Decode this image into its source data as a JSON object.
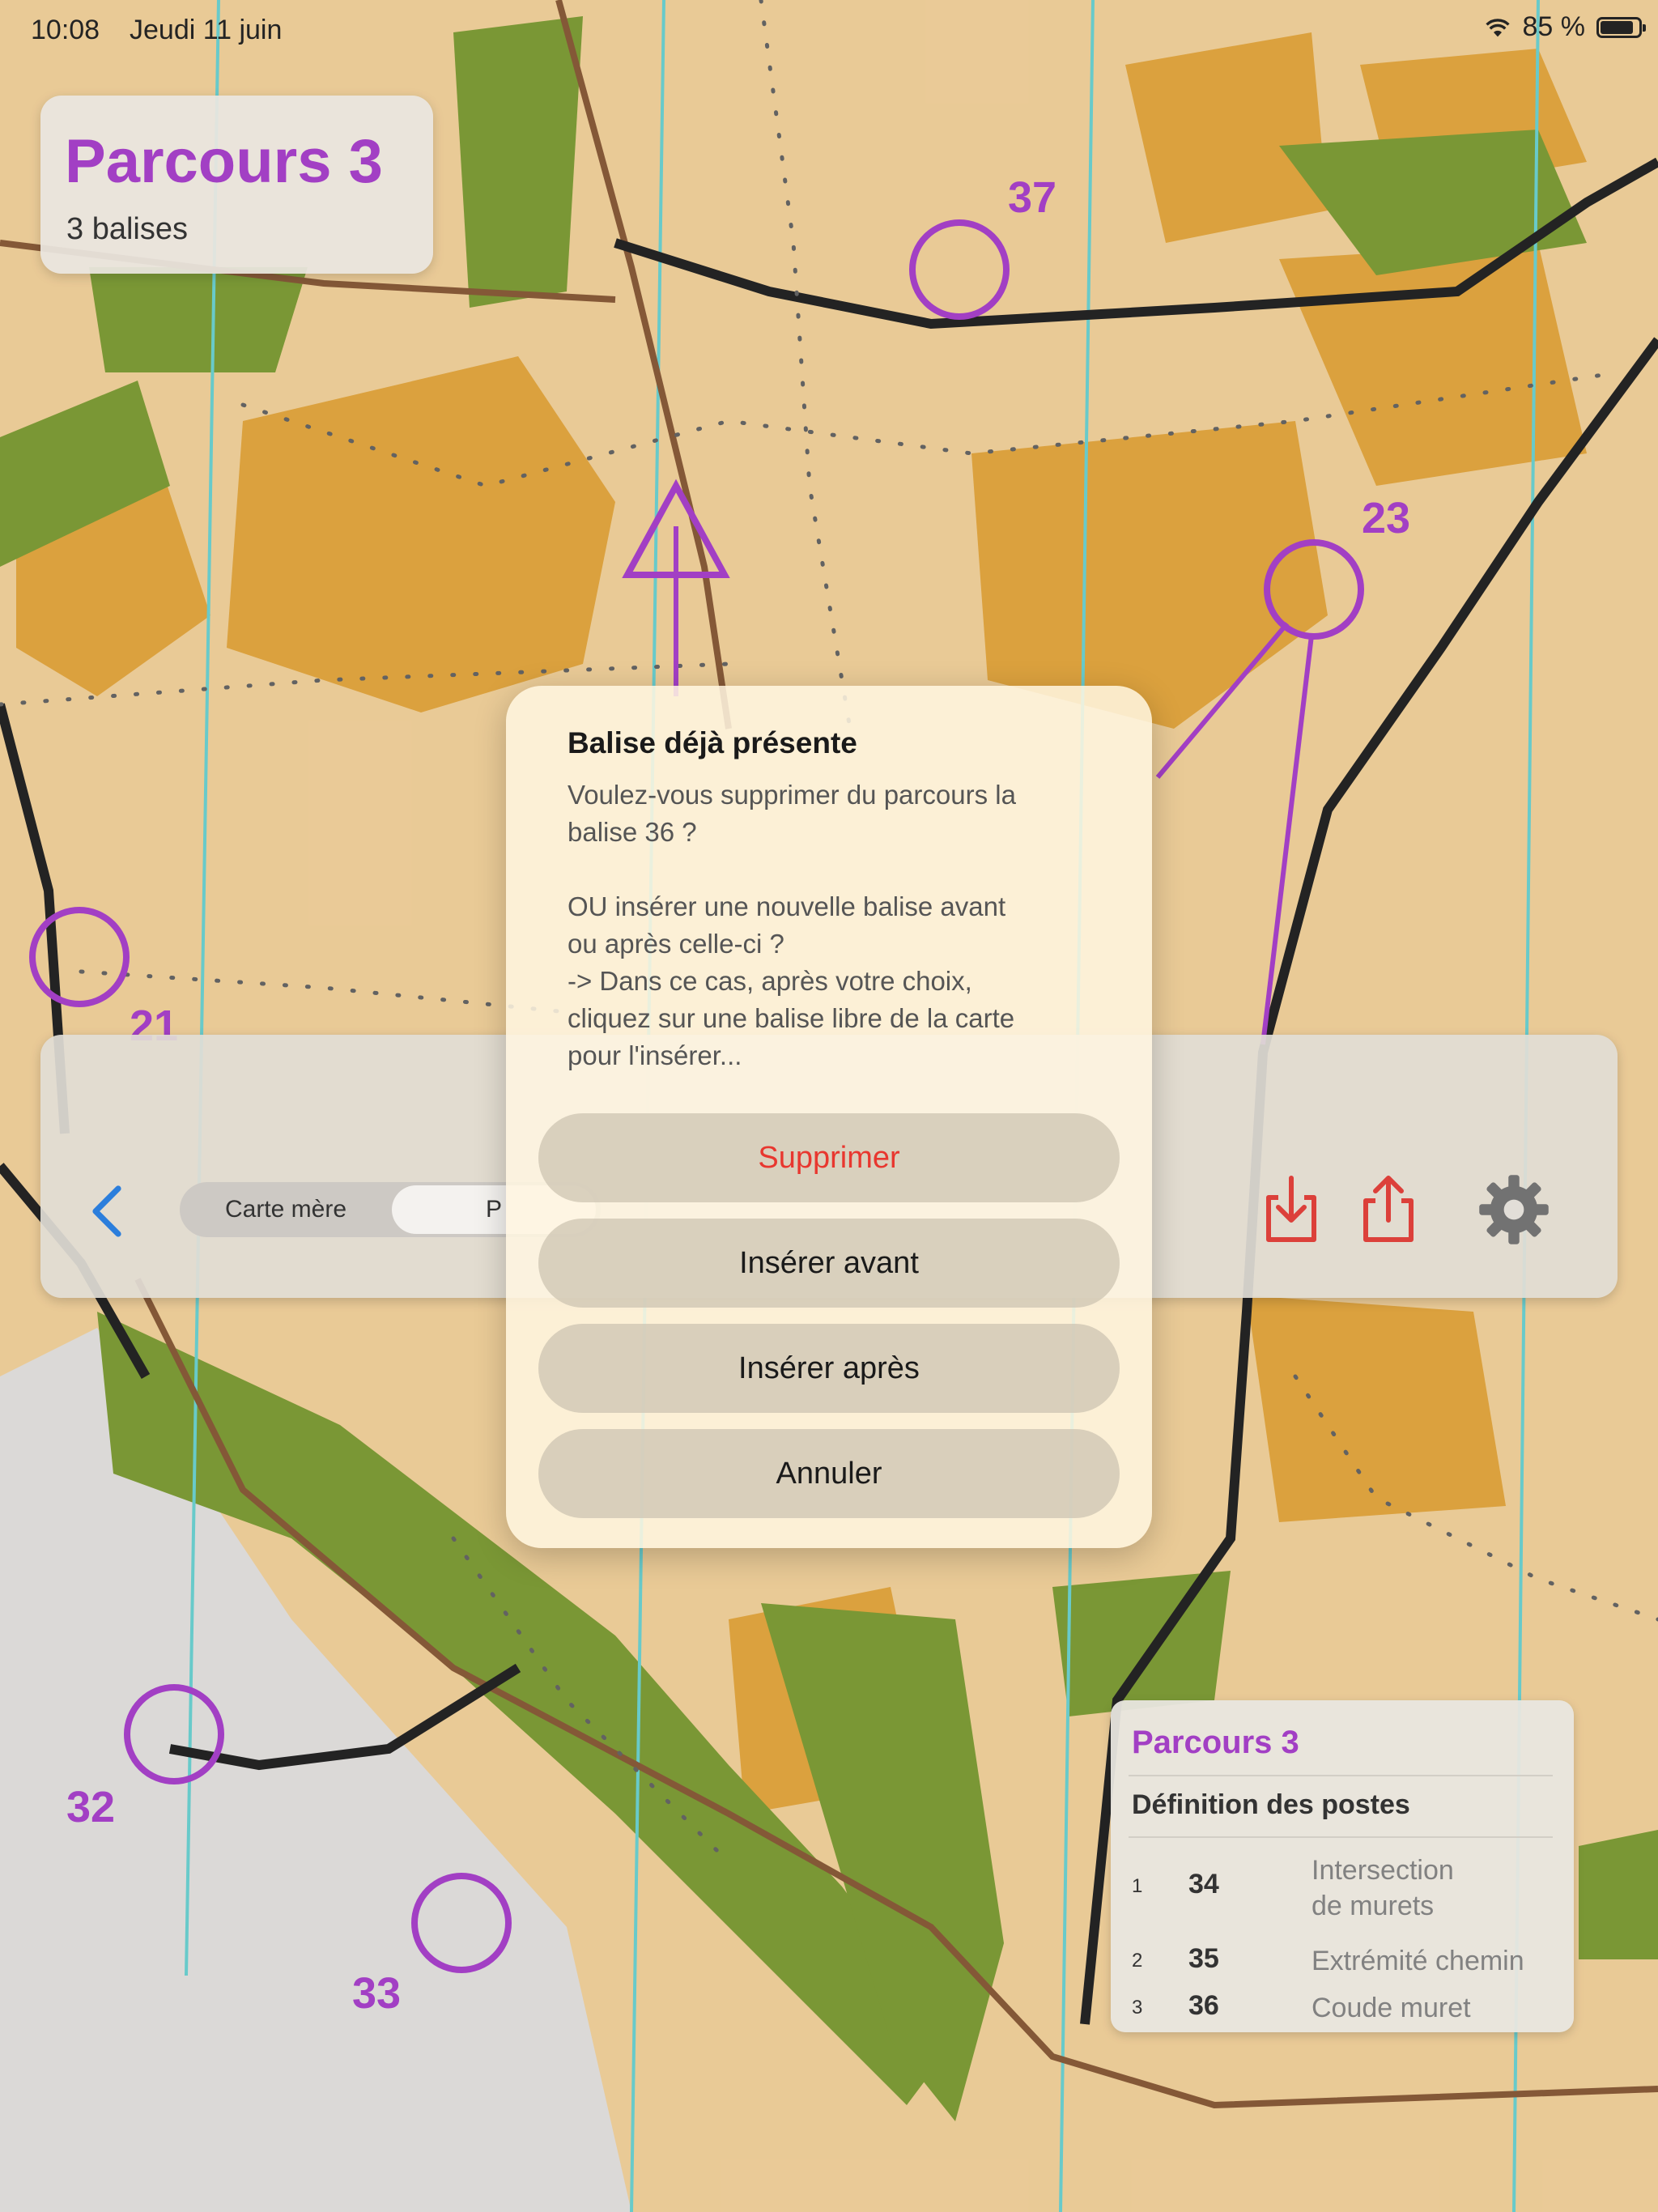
{
  "status_bar": {
    "time": "10:08",
    "date": "Jeudi 11 juin",
    "battery": "85 %"
  },
  "course": {
    "title": "Parcours 3",
    "subtitle": "3 balises"
  },
  "map": {
    "controls": [
      "37",
      "23",
      "21",
      "32",
      "33"
    ]
  },
  "toolbar": {
    "segments": [
      "Carte mère",
      "P"
    ]
  },
  "definition_card": {
    "title": "Parcours 3",
    "heading": "Définition des postes",
    "rows": [
      {
        "index": "1",
        "code": "34",
        "desc": "Intersection\nde murets"
      },
      {
        "index": "2",
        "code": "35",
        "desc": "Extrémité chemin"
      },
      {
        "index": "3",
        "code": "36",
        "desc": "Coude muret"
      }
    ]
  },
  "alert": {
    "title": "Balise déjà présente",
    "message": "Voulez-vous supprimer du parcours la\nbalise 36 ?\n\nOU insérer une nouvelle balise avant\nou après celle-ci ?\n-> Dans ce cas, après votre choix,\ncliquez sur une balise libre de la carte\npour l'insérer...",
    "buttons": {
      "delete": "Supprimer",
      "insert_before": "Insérer avant",
      "insert_after": "Insérer après",
      "cancel": "Annuler"
    }
  },
  "colors": {
    "accent": "#9b2fbf",
    "destructive": "#e8372f",
    "link": "#1a73d9",
    "icon_red": "#d9302a",
    "map_bg": "#e8c68e"
  }
}
